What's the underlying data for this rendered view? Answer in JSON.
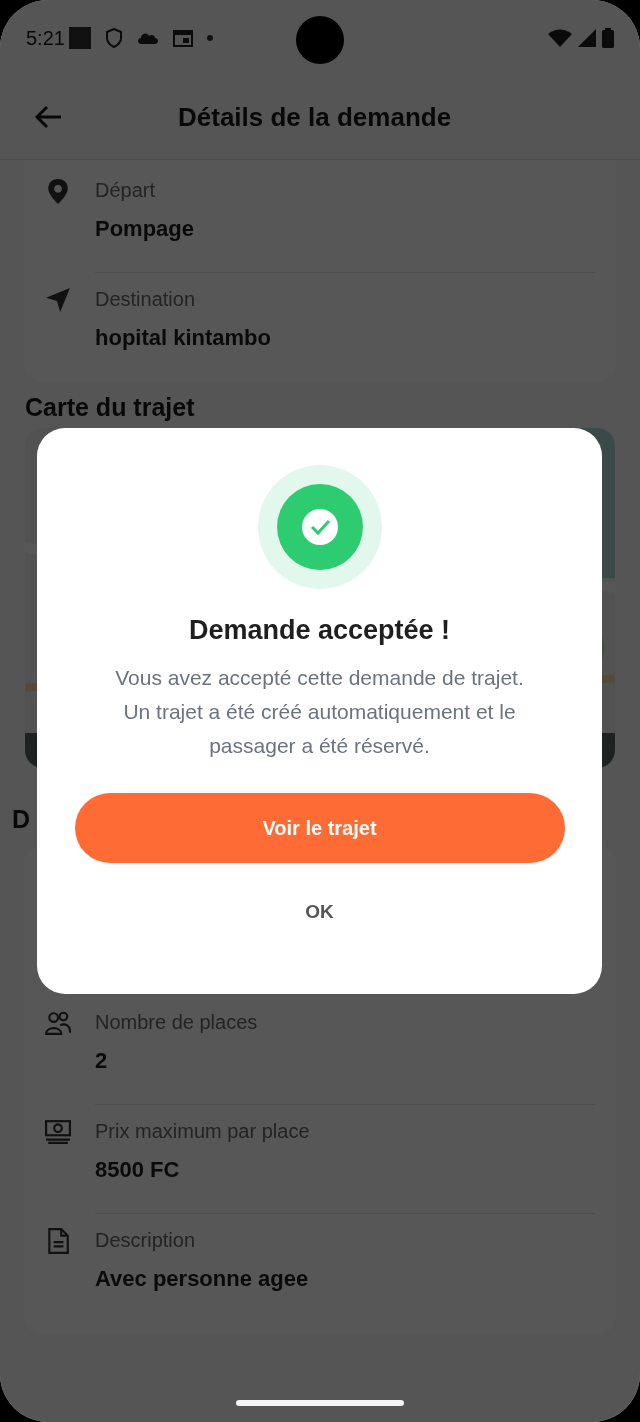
{
  "status_bar": {
    "time": "5:21"
  },
  "header": {
    "title": "Détails de la demande"
  },
  "route_card": {
    "rows": [
      {
        "kind": "departure",
        "label": "Départ",
        "value": "Pompage"
      },
      {
        "kind": "destination",
        "label": "Destination",
        "value": "hopital kintambo"
      }
    ]
  },
  "map_section": {
    "heading": "Carte du trajet"
  },
  "details_section": {
    "heading": "D",
    "rows": [
      {
        "kind": "seats",
        "label": "Nombre de places",
        "value": "2"
      },
      {
        "kind": "price",
        "label": "Prix maximum par place",
        "value": "8500 FC"
      },
      {
        "kind": "description",
        "label": "Description",
        "value": "Avec personne agee"
      }
    ]
  },
  "dialog": {
    "title": "Demande acceptée !",
    "message": "Vous avez accepté cette demande de trajet. Un trajet a été créé automatiquement et le passager a été réservé.",
    "primary_button": "Voir le trajet",
    "secondary_button": "OK"
  }
}
